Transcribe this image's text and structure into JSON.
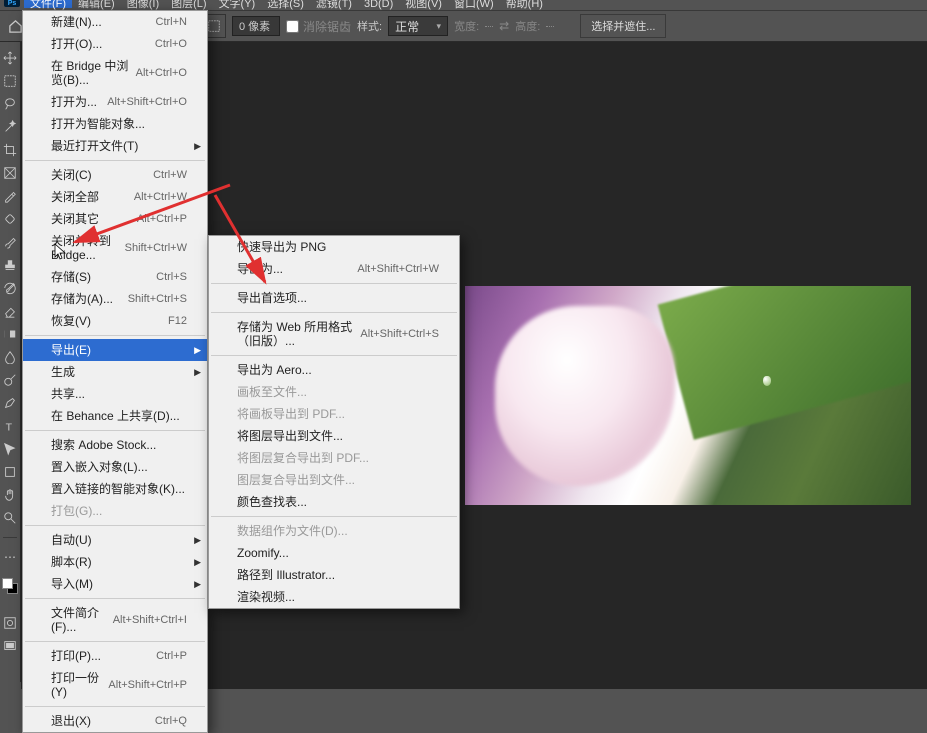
{
  "menubar": {
    "items": [
      "文件(F)",
      "编辑(E)",
      "图像(I)",
      "图层(L)",
      "文字(Y)",
      "选择(S)",
      "滤镜(T)",
      "3D(D)",
      "视图(V)",
      "窗口(W)",
      "帮助(H)"
    ]
  },
  "optionbar": {
    "px_value": "0 像素",
    "clear_btn": "消除锯齿",
    "style_label": "样式:",
    "style_value": "正常",
    "width_label": "宽度:",
    "height_label": "高度:",
    "select_mask": "选择并遮住..."
  },
  "file_menu": [
    {
      "t": "新建(N)...",
      "s": "Ctrl+N"
    },
    {
      "t": "打开(O)...",
      "s": "Ctrl+O"
    },
    {
      "t": "在 Bridge 中浏览(B)...",
      "s": "Alt+Ctrl+O"
    },
    {
      "t": "打开为...",
      "s": "Alt+Shift+Ctrl+O"
    },
    {
      "t": "打开为智能对象..."
    },
    {
      "t": "最近打开文件(T)",
      "sub": true
    },
    {
      "sep": true
    },
    {
      "t": "关闭(C)",
      "s": "Ctrl+W"
    },
    {
      "t": "关闭全部",
      "s": "Alt+Ctrl+W"
    },
    {
      "t": "关闭其它",
      "s": "Alt+Ctrl+P"
    },
    {
      "t": "关闭并转到 Bridge...",
      "s": "Shift+Ctrl+W"
    },
    {
      "t": "存储(S)",
      "s": "Ctrl+S"
    },
    {
      "t": "存储为(A)...",
      "s": "Shift+Ctrl+S"
    },
    {
      "t": "恢复(V)",
      "s": "F12"
    },
    {
      "sep": true
    },
    {
      "t": "导出(E)",
      "sub": true,
      "hl": true
    },
    {
      "t": "生成",
      "sub": true
    },
    {
      "t": "共享..."
    },
    {
      "t": "在 Behance 上共享(D)..."
    },
    {
      "sep": true
    },
    {
      "t": "搜索 Adobe Stock..."
    },
    {
      "t": "置入嵌入对象(L)..."
    },
    {
      "t": "置入链接的智能对象(K)..."
    },
    {
      "t": "打包(G)...",
      "dim": true
    },
    {
      "sep": true
    },
    {
      "t": "自动(U)",
      "sub": true
    },
    {
      "t": "脚本(R)",
      "sub": true
    },
    {
      "t": "导入(M)",
      "sub": true
    },
    {
      "sep": true
    },
    {
      "t": "文件简介(F)...",
      "s": "Alt+Shift+Ctrl+I"
    },
    {
      "sep": true
    },
    {
      "t": "打印(P)...",
      "s": "Ctrl+P"
    },
    {
      "t": "打印一份(Y)",
      "s": "Alt+Shift+Ctrl+P"
    },
    {
      "sep": true
    },
    {
      "t": "退出(X)",
      "s": "Ctrl+Q"
    }
  ],
  "export_menu": [
    {
      "t": "快速导出为 PNG"
    },
    {
      "t": "导出为...",
      "s": "Alt+Shift+Ctrl+W"
    },
    {
      "sep": true
    },
    {
      "t": "导出首选项..."
    },
    {
      "sep": true
    },
    {
      "t": "存储为 Web 所用格式（旧版）...",
      "s": "Alt+Shift+Ctrl+S"
    },
    {
      "sep": true
    },
    {
      "t": "导出为 Aero..."
    },
    {
      "t": "画板至文件...",
      "dim": true
    },
    {
      "t": "将画板导出到 PDF...",
      "dim": true
    },
    {
      "t": "将图层导出到文件..."
    },
    {
      "t": "将图层复合导出到 PDF...",
      "dim": true
    },
    {
      "t": "图层复合导出到文件...",
      "dim": true
    },
    {
      "t": "颜色查找表..."
    },
    {
      "sep": true
    },
    {
      "t": "数据组作为文件(D)...",
      "dim": true
    },
    {
      "t": "Zoomify..."
    },
    {
      "t": "路径到 Illustrator..."
    },
    {
      "t": "渲染视频..."
    }
  ]
}
